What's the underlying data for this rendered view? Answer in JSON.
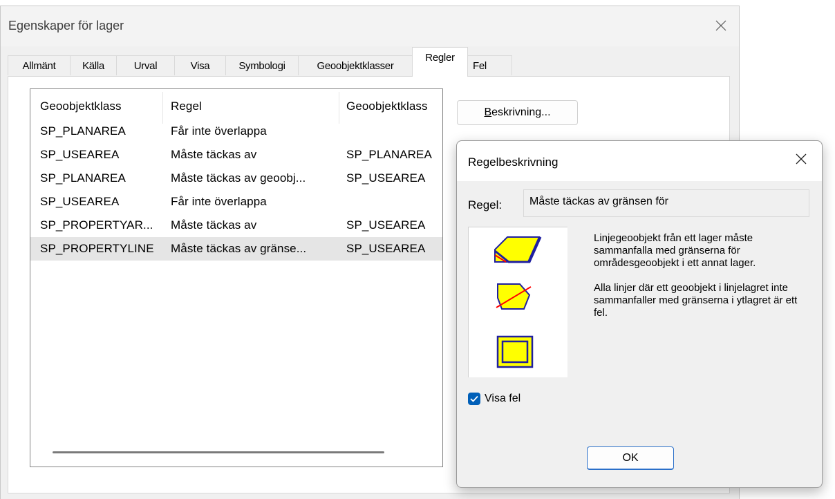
{
  "main_window": {
    "title": "Egenskaper för lager",
    "tabs": [
      "Allmänt",
      "Källa",
      "Urval",
      "Visa",
      "Symbologi",
      "Geoobjektklasser",
      "Regler",
      "Fel"
    ],
    "active_tab": "Regler",
    "rules_table": {
      "columns": [
        "Geoobjektklass",
        "Regel",
        "Geoobjektklass"
      ],
      "rows": [
        [
          "SP_PLANAREA",
          "Får inte överlappa",
          ""
        ],
        [
          "SP_USEAREA",
          "Måste täckas av",
          "SP_PLANAREA"
        ],
        [
          "SP_PLANAREA",
          "Måste täckas av geoobj...",
          "SP_USEAREA"
        ],
        [
          "SP_USEAREA",
          "Får inte överlappa",
          ""
        ],
        [
          "SP_PROPERTYAR...",
          "Måste täckas av",
          "SP_USEAREA"
        ],
        [
          "SP_PROPERTYLINE",
          "Måste täckas av gränse...",
          "SP_USEAREA"
        ]
      ],
      "selected_row": 5
    },
    "description_button": {
      "underlined": "B",
      "rest": "eskrivning..."
    }
  },
  "rule_dialog": {
    "title": "Regelbeskrivning",
    "rule_label": "Regel:",
    "rule_value": "Måste täckas av gränsen för",
    "description_paragraphs": [
      "Linjegeoobjekt från ett lager måste sammanfalla med gränserna för områdesgeoobjekt i ett annat lager.",
      "Alla linjer där ett geoobjekt i linjelagret inte sammanfaller med gränserna i ytlagret är ett fel."
    ],
    "show_errors_label": "Visa fel",
    "show_errors_checked": true,
    "ok_label": "OK",
    "icons": [
      "rule-valid-example-icon",
      "rule-error-example-icon",
      "rule-covered-polygon-icon",
      "close-icon",
      "checkmark-icon"
    ],
    "colors": {
      "fill": "#ffff00",
      "line": "#1f1fa0",
      "error": "#ff0000",
      "accent": "#005fb8"
    }
  }
}
